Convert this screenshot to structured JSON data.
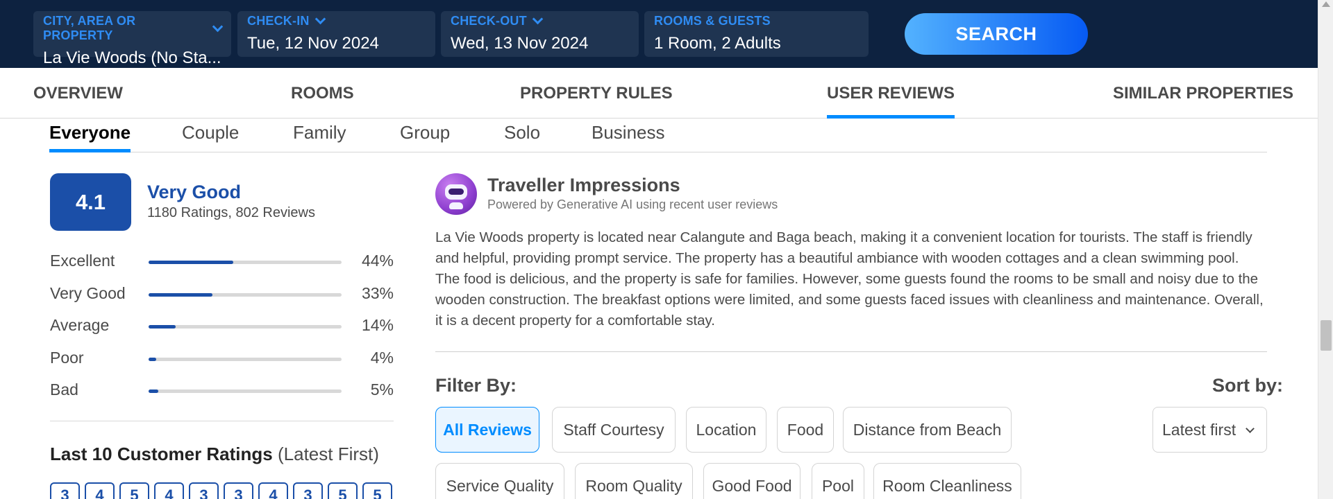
{
  "search": {
    "city": {
      "label": "CITY, AREA OR PROPERTY",
      "value": "La Vie Woods (No Sta..."
    },
    "checkin": {
      "label": "CHECK-IN",
      "value": "Tue, 12 Nov 2024"
    },
    "checkout": {
      "label": "CHECK-OUT",
      "value": "Wed, 13 Nov 2024"
    },
    "guests": {
      "label": "ROOMS & GUESTS",
      "value": "1 Room, 2 Adults"
    },
    "button": "SEARCH"
  },
  "nav": [
    "OVERVIEW",
    "ROOMS",
    "PROPERTY RULES",
    "USER REVIEWS",
    "SIMILAR PROPERTIES"
  ],
  "nav_active": "USER REVIEWS",
  "traveller_tabs": [
    "Everyone",
    "Couple",
    "Family",
    "Group",
    "Solo",
    "Business"
  ],
  "rating": {
    "score": "4.1",
    "label": "Very Good",
    "counts": "1180 Ratings, 802 Reviews",
    "distribution": [
      {
        "name": "Excellent",
        "percent": 44,
        "label": "44%"
      },
      {
        "name": "Very Good",
        "percent": 33,
        "label": "33%"
      },
      {
        "name": "Average",
        "percent": 14,
        "label": "14%"
      },
      {
        "name": "Poor",
        "percent": 4,
        "label": "4%"
      },
      {
        "name": "Bad",
        "percent": 5,
        "label": "5%"
      }
    ]
  },
  "last10": {
    "title": "Last 10 Customer Ratings",
    "suffix": "(Latest First)",
    "ratings": [
      "3",
      "4",
      "5",
      "4",
      "3",
      "3",
      "4",
      "3",
      "5",
      "5"
    ]
  },
  "ai": {
    "title": "Traveller Impressions",
    "subtitle": "Powered by Generative AI using recent user reviews",
    "text": "La Vie Woods property is located near Calangute and Baga beach, making it a convenient location for tourists. The staff is friendly and helpful, providing prompt service. The property has a beautiful ambiance with wooden cottages and a clean swimming pool. The food is delicious, and the property is safe for families. However, some guests found the rooms to be small and noisy due to the wooden construction. The breakfast options were limited, and some guests faced issues with cleanliness and maintenance. Overall, it is a decent property for a comfortable stay."
  },
  "filters": {
    "label": "Filter By:",
    "sort_label": "Sort by:",
    "sort_value": "Latest first",
    "chips": [
      "All Reviews",
      "Staff Courtesy",
      "Location",
      "Food",
      "Distance from Beach",
      "Service Quality",
      "Room Quality",
      "Good Food",
      "Pool",
      "Room Cleanliness"
    ],
    "active": "All Reviews"
  },
  "colors": {
    "accent": "#008cff",
    "rating_blue": "#1b4fa8",
    "header_bg": "#0d2240"
  },
  "icons": {
    "ai_avatar": "robot-icon",
    "dropdown": "chevron-down-icon"
  }
}
